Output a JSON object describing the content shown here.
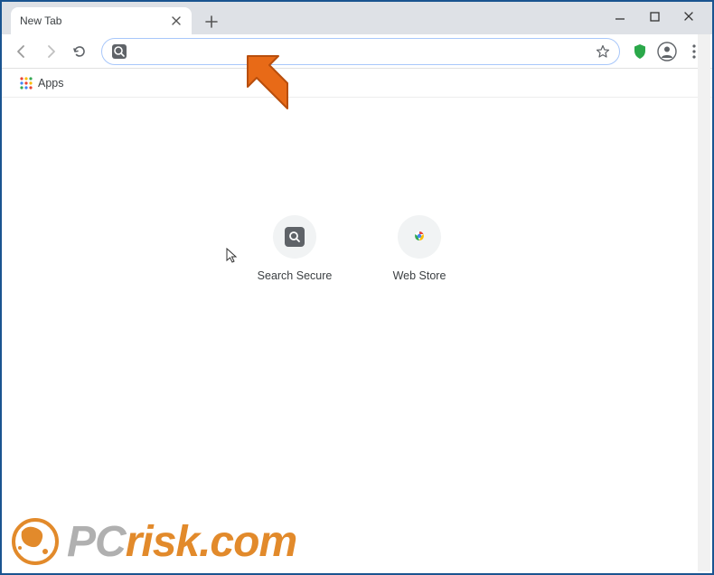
{
  "window": {
    "tab_title": "New Tab"
  },
  "bookmarks": {
    "apps_label": "Apps"
  },
  "omnibox": {
    "value": "",
    "placeholder": ""
  },
  "shortcuts": [
    {
      "label": "Search Secure",
      "icon": "search-shield"
    },
    {
      "label": "Web Store",
      "icon": "chrome-store"
    }
  ],
  "watermark": {
    "part1": "PC",
    "part2": "risk.com"
  },
  "colors": {
    "accent_blue": "#1a5490",
    "orange": "#E86A17",
    "shield_green": "#2ba84a"
  }
}
